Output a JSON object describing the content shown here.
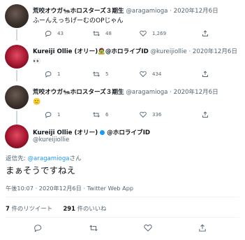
{
  "tweets": [
    {
      "name": "荒咬オウガ🐜ホロスターズ３期生",
      "handle": "@aragamioga",
      "date": "2020年12月6日",
      "text": "ふーんえっちげーむのOPじゃん",
      "replies": "43",
      "retweets": "48",
      "likes": "1,269"
    },
    {
      "name": "Kureiji Ollie (オリー)🧟@ホロライブID",
      "handle": "@kureijiollie",
      "date": "2020年12月6日",
      "text": "👀",
      "replies": "1",
      "retweets": "5",
      "likes": "434"
    },
    {
      "name": "荒咬オウガ🐜ホロスターズ３期生",
      "handle": "@aragamioga",
      "date": "2020年12月6日",
      "text": "🙂",
      "replies": "1",
      "retweets": "6",
      "likes": "336"
    }
  ],
  "main_tweet": {
    "name": "Kureiji Ollie (オリー)",
    "name_suffix": "@ホロライブID",
    "handle": "@kureijiollie",
    "reply_prefix": "返信先: ",
    "reply_mention": "@aragamioga",
    "reply_suffix": "さん",
    "text": "まぁそうですねえ",
    "timestamp": "午後10:07 · 2020年12月6日 · Twitter Web App",
    "retweet_count": "7",
    "retweet_label": " 件のリツイート",
    "like_count": "291",
    "like_label": " 件のいいね"
  },
  "colors": {
    "accent": "#1d9bf0",
    "secondary_text": "#536471",
    "divider": "#eff3f4"
  }
}
